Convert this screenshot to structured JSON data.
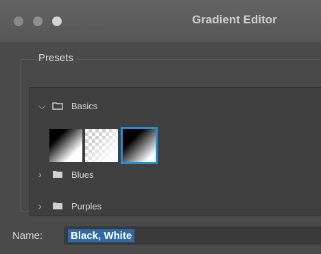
{
  "window": {
    "title": "Gradient Editor"
  },
  "presets": {
    "label": "Presets",
    "folders": [
      {
        "label": "Basics",
        "expanded": true,
        "chevron": "chevron-down-icon"
      },
      {
        "label": "Blues",
        "expanded": false,
        "chevron": "chevron-right-icon"
      },
      {
        "label": "Purples",
        "expanded": false,
        "chevron": "chevron-right-icon"
      }
    ],
    "swatches": [
      {
        "name": "black-white-gradient"
      },
      {
        "name": "transparent-white-gradient"
      },
      {
        "name": "black-white-gradient-selected",
        "selected": true
      }
    ]
  },
  "name_field": {
    "label": "Name:",
    "value": "Black, White"
  },
  "colors": {
    "selection": "#1e8fd6",
    "text_highlight": "#2f69a8"
  }
}
